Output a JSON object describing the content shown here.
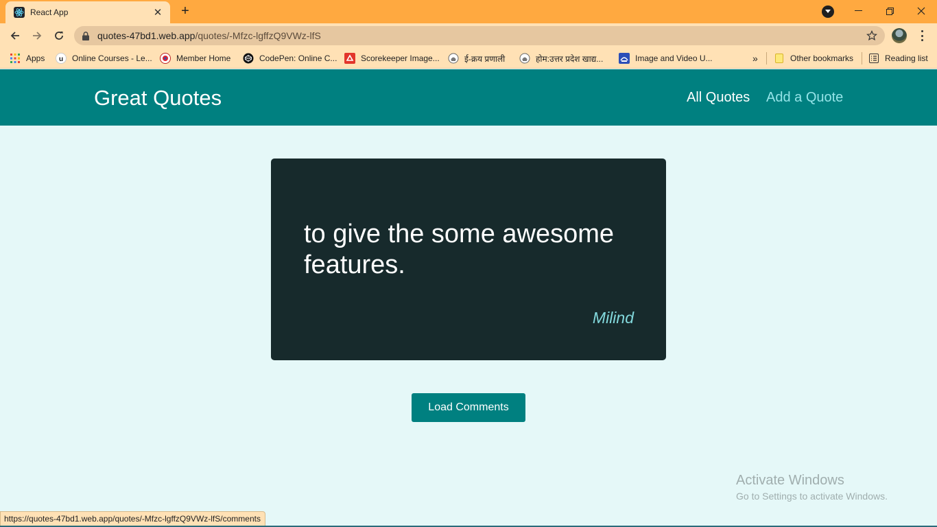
{
  "browser": {
    "tab": {
      "title": "React App"
    },
    "url": {
      "host": "quotes-47bd1.web.app",
      "path": "/quotes/-Mfzc-lgffzQ9VWz-lfS"
    },
    "bookmarks": [
      {
        "label": "Apps",
        "icon": "apps-grid-icon"
      },
      {
        "label": "Online Courses - Le...",
        "icon": "udemy-icon"
      },
      {
        "label": "Member Home",
        "icon": "member-home-icon"
      },
      {
        "label": "CodePen: Online C...",
        "icon": "codepen-icon"
      },
      {
        "label": "Scorekeeper Image...",
        "icon": "scorekeeper-icon"
      },
      {
        "label": "ई-क्रय प्रणाली",
        "icon": "emblem-icon"
      },
      {
        "label": "होम:उत्तर प्रदेश खाद्य...",
        "icon": "emblem-icon"
      },
      {
        "label": "Image and Video U...",
        "icon": "image-upload-icon"
      }
    ],
    "bookmarks_overflow": "»",
    "other_bookmarks": "Other bookmarks",
    "reading_list": "Reading list",
    "status_url": "https://quotes-47bd1.web.app/quotes/-Mfzc-lgffzQ9VWz-lfS/comments"
  },
  "app": {
    "logo": "Great Quotes",
    "nav": {
      "all_quotes": "All Quotes",
      "add_quote": "Add a Quote"
    },
    "quote": {
      "text": "to give the some awesome features.",
      "author": "Milind"
    },
    "load_comments": "Load Comments"
  },
  "watermark": {
    "title": "Activate Windows",
    "subtitle": "Go to Settings to activate Windows."
  },
  "colors": {
    "tab_strip": "#ffa940",
    "toolbar": "#ffe1b5",
    "header": "#008080",
    "page_bg": "#e5f8f8",
    "card": "#172a2c",
    "author": "#83d9dd",
    "nav_active": "#ffffff",
    "nav_inactive": "#95e4e8"
  }
}
